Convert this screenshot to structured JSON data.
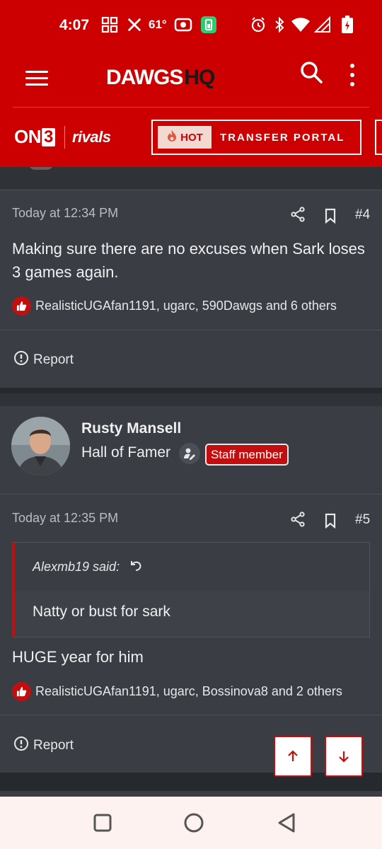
{
  "status_bar": {
    "time": "4:07",
    "temperature": "61°",
    "icons": [
      "grid-icon",
      "x-icon",
      "cast-icon",
      "battery-saver-icon",
      "alarm-icon",
      "bluetooth-icon",
      "wifi-icon",
      "signal-icon",
      "battery-icon"
    ]
  },
  "header": {
    "logo_main": "DAWGS",
    "logo_accent": "HQ",
    "brand_color": "#cc0000"
  },
  "partner_bar": {
    "on3_text": "ON",
    "on3_number": "3",
    "rivals_text": "rivals",
    "hot_label": "HOT",
    "transfer_portal_label": "TRANSFER PORTAL"
  },
  "posts": [
    {
      "timestamp": "Today at 12:34 PM",
      "number": "#4",
      "body": "Making sure there are no excuses when Sark loses 3 games again.",
      "reactions": "RealisticUGAfan1191, ugarc, 590Dawgs and 6 others",
      "report_label": "Report"
    },
    {
      "author": "Rusty Mansell",
      "author_title": "Hall of Famer",
      "staff_badge": "Staff member",
      "timestamp": "Today at 12:35 PM",
      "number": "#5",
      "quote_author": "Alexmb19 said:",
      "quote_body": "Natty or bust for sark",
      "body": "HUGE year for him",
      "reactions": "RealisticUGAfan1191, ugarc, Bossinova8 and 2 others",
      "report_label": "Report"
    }
  ],
  "accent_color": "#c20e0e"
}
